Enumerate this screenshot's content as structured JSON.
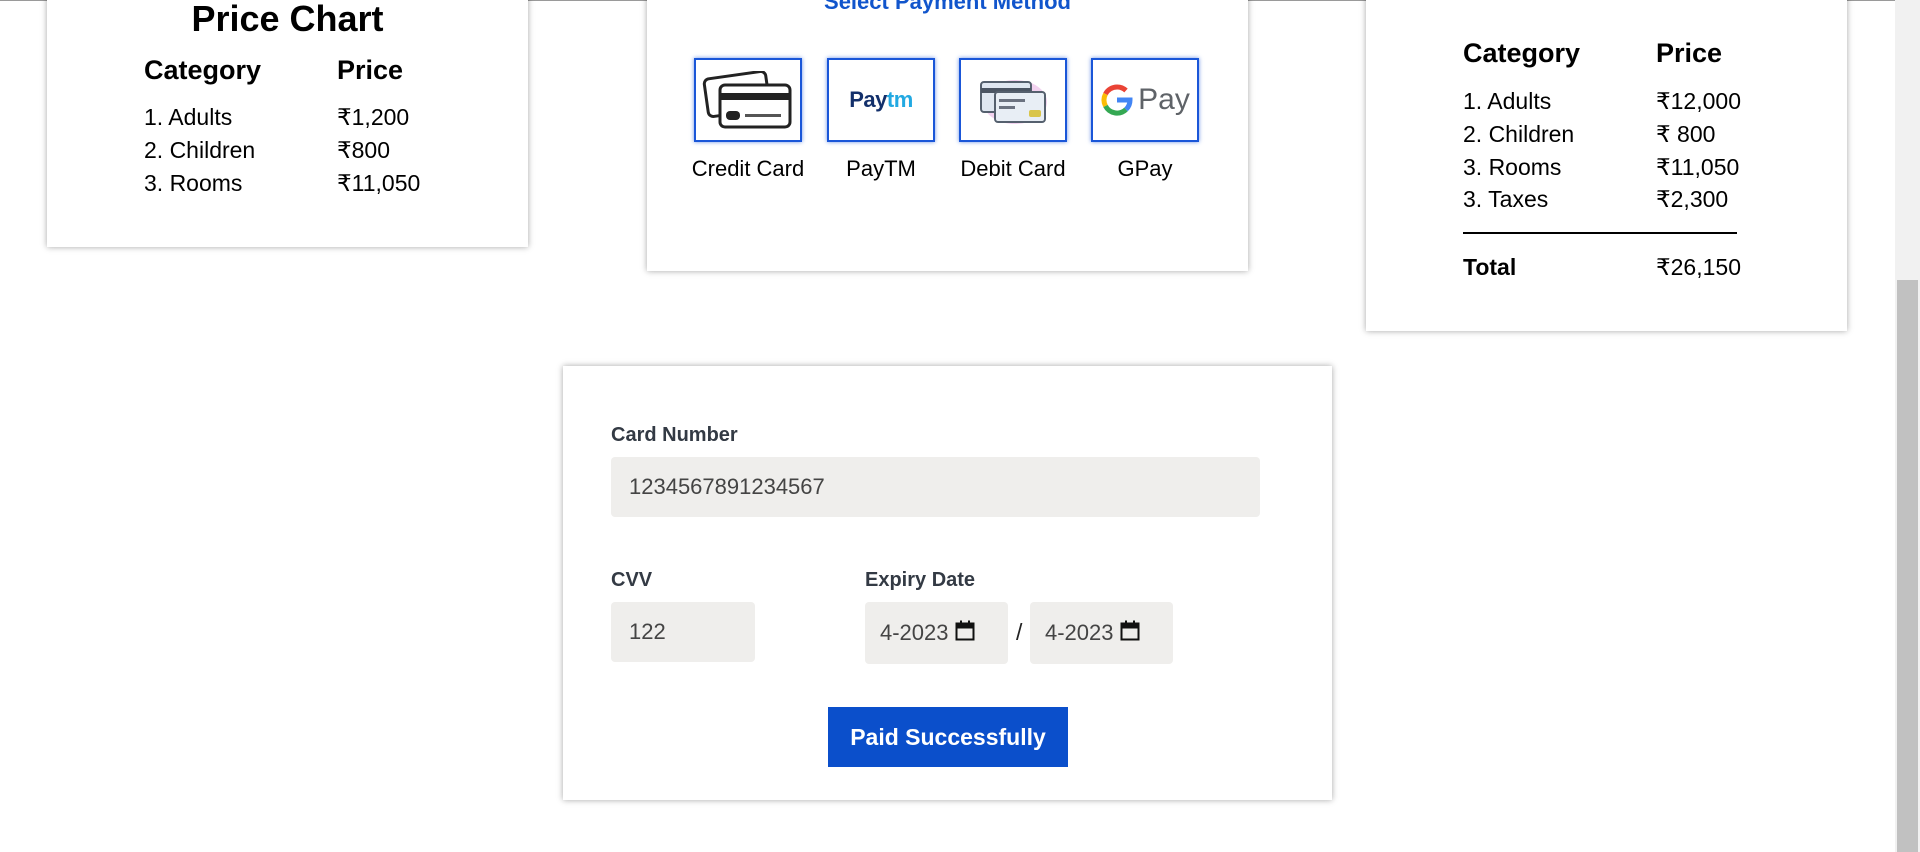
{
  "price_chart": {
    "title": "Price Chart",
    "headers": {
      "category": "Category",
      "price": "Price"
    },
    "rows": [
      {
        "category": "1. Adults",
        "price": "₹1,200"
      },
      {
        "category": "2. Children",
        "price": "₹800"
      },
      {
        "category": "3. Rooms",
        "price": "₹11,050"
      }
    ]
  },
  "payment_method": {
    "title": "Select Payment Method",
    "methods": [
      {
        "label": "Credit Card",
        "icon": "credit-card-icon"
      },
      {
        "label": "PayTM",
        "icon": "paytm-logo",
        "logo_text_a": "Pay",
        "logo_text_b": "tm"
      },
      {
        "label": "Debit Card",
        "icon": "debit-card-icon"
      },
      {
        "label": "GPay",
        "icon": "gpay-logo",
        "logo_text": "Pay"
      }
    ]
  },
  "summary": {
    "headers": {
      "category": "Category",
      "price": "Price"
    },
    "rows": [
      {
        "category": "1. Adults",
        "price": "₹12,000"
      },
      {
        "category": "2. Children",
        "price": "₹ 800"
      },
      {
        "category": "3. Rooms",
        "price": "₹11,050"
      },
      {
        "category": "3. Taxes",
        "price": "₹2,300"
      }
    ],
    "total_label": "Total",
    "total_value": "₹26,150"
  },
  "form": {
    "card_number_label": "Card Number",
    "card_number_value": "1234567891234567",
    "cvv_label": "CVV",
    "cvv_value": "122",
    "expiry_label": "Expiry Date",
    "expiry_start": "4-2023",
    "expiry_end": "4-2023",
    "separator": "/",
    "submit_label": "Paid Successfully"
  },
  "colors": {
    "accent": "#0b4fcb",
    "method_border": "#1a56d8",
    "input_bg": "#efeeec"
  }
}
